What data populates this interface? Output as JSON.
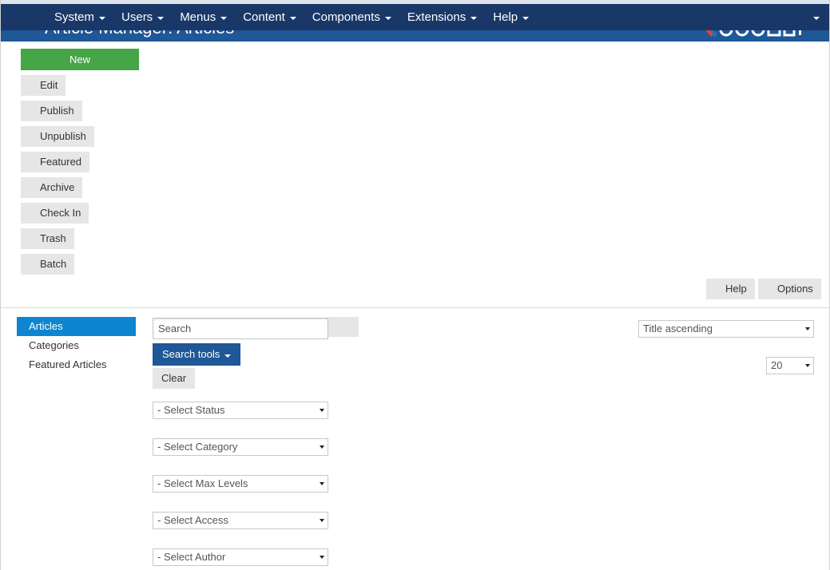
{
  "window": {
    "page_title": "Article Manager: Articles"
  },
  "nav": {
    "items": [
      {
        "label": "System"
      },
      {
        "label": "Users"
      },
      {
        "label": "Menus"
      },
      {
        "label": "Content"
      },
      {
        "label": "Components"
      },
      {
        "label": "Extensions"
      },
      {
        "label": "Help"
      }
    ]
  },
  "toolbar": {
    "new_label": "New",
    "edit_label": "Edit",
    "publish_label": "Publish",
    "unpublish_label": "Unpublish",
    "featured_label": "Featured",
    "archive_label": "Archive",
    "checkin_label": "Check In",
    "trash_label": "Trash",
    "batch_label": "Batch",
    "help_label": "Help",
    "options_label": "Options"
  },
  "sidebar": {
    "items": [
      {
        "label": "Articles",
        "active": true
      },
      {
        "label": "Categories",
        "active": false
      },
      {
        "label": "Featured Articles",
        "active": false
      }
    ]
  },
  "search": {
    "placeholder": "Search",
    "value": "",
    "search_tools_label": "Search tools",
    "clear_label": "Clear"
  },
  "filters": {
    "status": "- Select Status",
    "category": "- Select Category",
    "max_levels": "- Select Max Levels",
    "access": "- Select Access",
    "author": "- Select Author"
  },
  "list": {
    "ordering": "Title ascending",
    "limit": "20"
  },
  "colors": {
    "navbar_bg": "#1a3867",
    "subhead_bg": "#1f5797",
    "new_button": "#46a546",
    "active_sidebar": "#0e86cf",
    "search_tools_button": "#1f5797"
  }
}
